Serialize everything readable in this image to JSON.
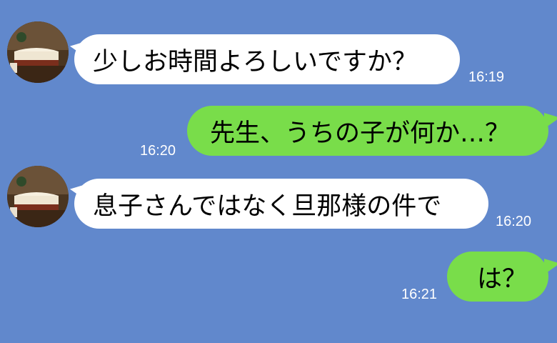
{
  "messages": [
    {
      "side": "in",
      "text": "少しお時間よろしいですか？",
      "time": "16:19"
    },
    {
      "side": "out",
      "text": "先生、うちの子が何か…？",
      "time": "16:20"
    },
    {
      "side": "in",
      "text": "息子さんではなく旦那様の件で",
      "time": "16:20"
    },
    {
      "side": "out",
      "text": "は？",
      "time": "16:21"
    }
  ],
  "colors": {
    "background": "#6188cc",
    "incoming_bubble": "#ffffff",
    "outgoing_bubble": "#79dd4a",
    "timestamp": "#ffffff"
  },
  "icons": {
    "avatar": "book-avatar-icon"
  }
}
